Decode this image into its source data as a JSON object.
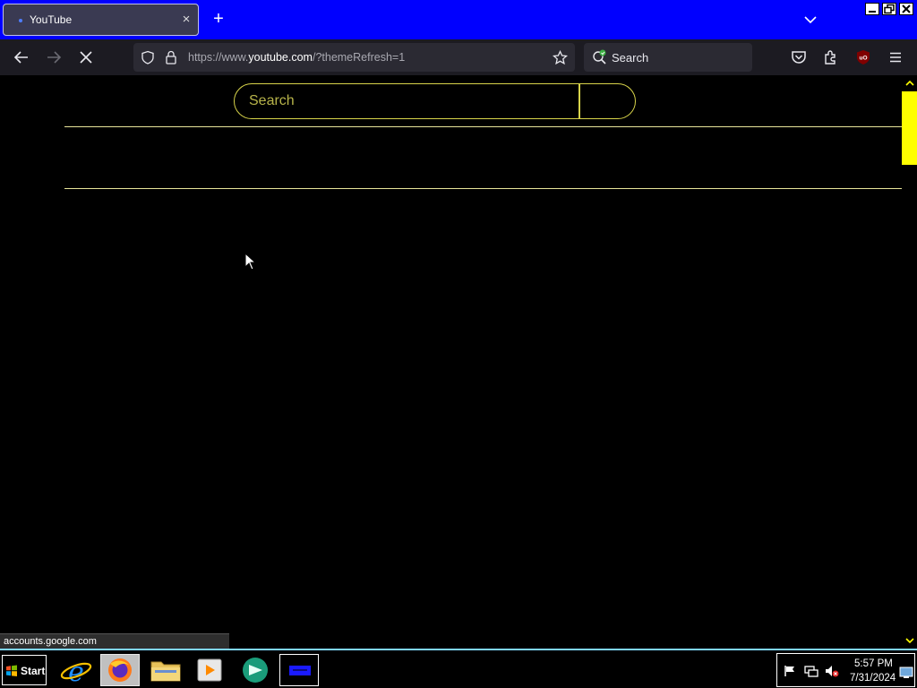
{
  "browser": {
    "tab": {
      "title": "YouTube",
      "close": "×"
    },
    "new_tab": "+",
    "url": {
      "prefix": "https://www.",
      "host": "youtube.com",
      "path": "/?themeRefresh=1"
    },
    "search_placeholder": "Search"
  },
  "page": {
    "search_placeholder": "Search",
    "status_text": "accounts.google.com"
  },
  "taskbar": {
    "start_label": "Start",
    "time": "5:57 PM",
    "date": "7/31/2024"
  },
  "colors": {
    "titlebar": "#0000ff",
    "accent_yellow": "#ffff00",
    "search_border": "#d8d44a",
    "taskbar_border": "#7fd6ff"
  }
}
